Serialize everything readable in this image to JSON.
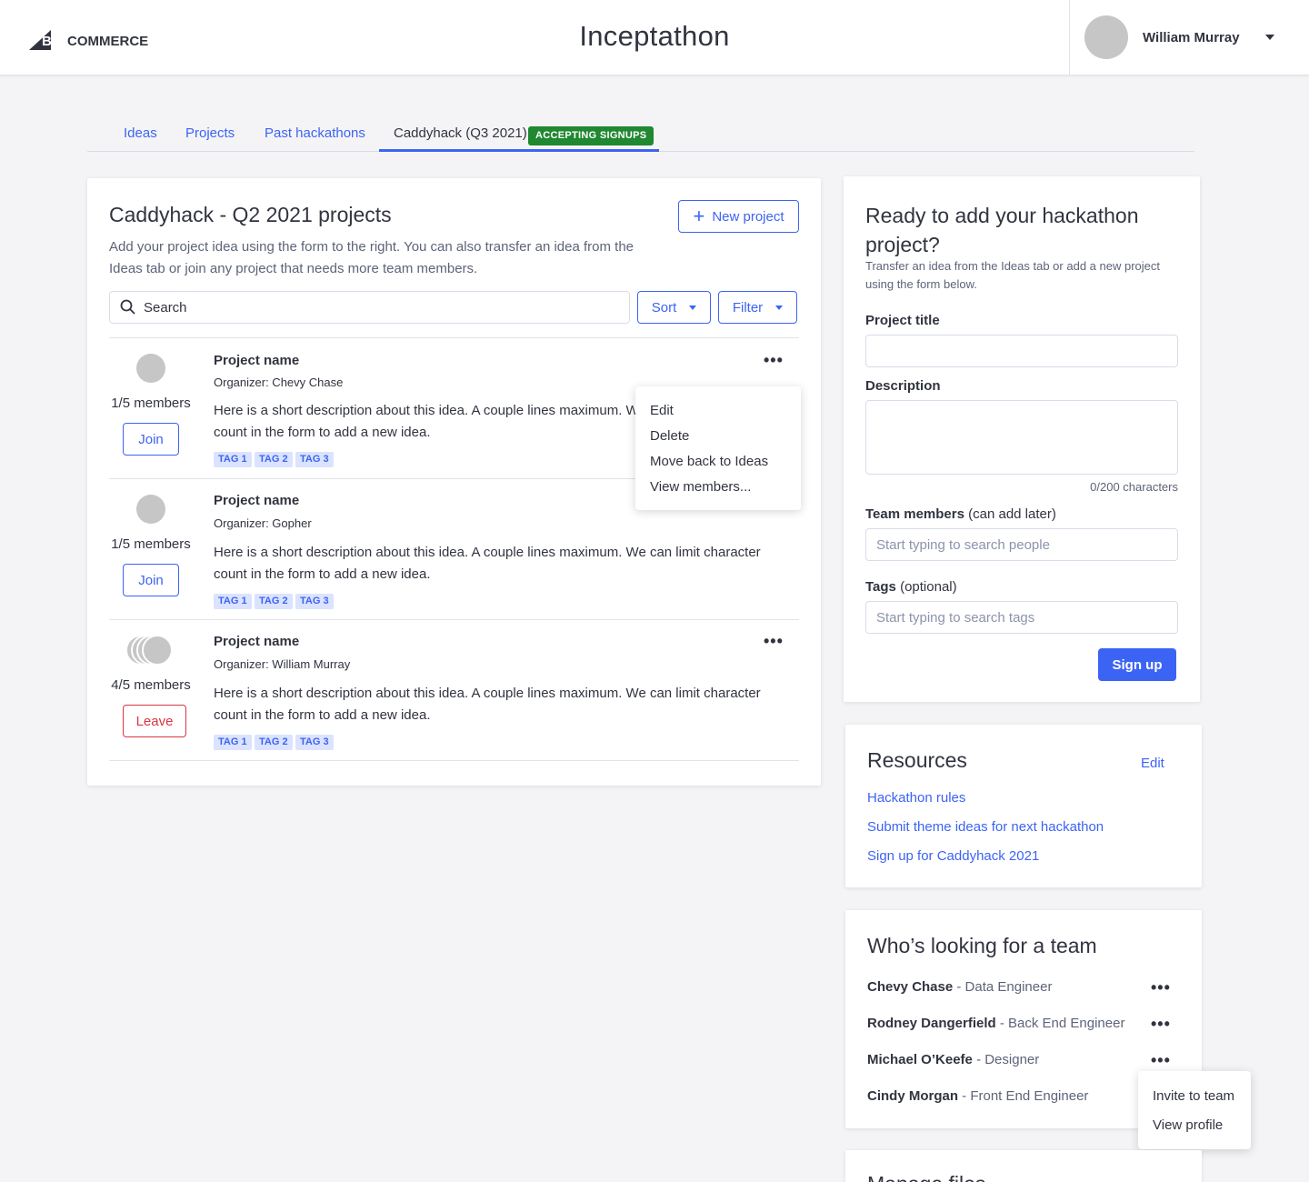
{
  "header": {
    "app_title": "Inceptathon",
    "logo_text_big": "BIG",
    "logo_text_commerce": "COMMERCE",
    "user_name": "William Murray"
  },
  "tabs": [
    {
      "label": "Ideas"
    },
    {
      "label": "Projects"
    },
    {
      "label": "Past hackathons"
    },
    {
      "label": "Caddyhack (Q3 2021)",
      "badge": "ACCEPTING SIGNUPS",
      "active": true
    }
  ],
  "projects": {
    "title": "Caddyhack - Q2 2021 projects",
    "subtitle_line1": "Add your project idea using the form to the right. You can also transfer an idea from the",
    "subtitle_line2": "Ideas tab or join any project that needs more team members.",
    "new_project_label": "New project",
    "search_placeholder": "Search",
    "sort_label": "Sort",
    "filter_label": "Filter",
    "items": [
      {
        "name": "Project name",
        "organizer": "Organizer: Chevy Chase",
        "members": "1/5 members",
        "action": "Join",
        "desc_line1": "Here is a short description about this idea. A couple lines maximum. We can limit character",
        "desc_line2": "count in the form to add a new idea.",
        "tags": [
          "TAG 1",
          "TAG 2",
          "TAG 3"
        ]
      },
      {
        "name": "Project name",
        "organizer": "Organizer: Gopher",
        "members": "1/5 members",
        "action": "Join",
        "desc_line1": "Here is a short description about this idea. A couple lines maximum. We can limit character",
        "desc_line2": "count in the form to add a new idea.",
        "tags": [
          "TAG 1",
          "TAG 2",
          "TAG 3"
        ]
      },
      {
        "name": "Project name",
        "organizer": "Organizer: William Murray",
        "members": "4/5 members",
        "action": "Leave",
        "desc_line1": "Here is a short description about this idea. A couple lines maximum. We can limit character",
        "desc_line2": "count in the form to add a new idea.",
        "tags": [
          "TAG 1",
          "TAG 2",
          "TAG 3"
        ]
      }
    ],
    "context_menu": [
      "Edit",
      "Delete",
      "Move back to Ideas",
      "View members..."
    ]
  },
  "form": {
    "title_line1": "Ready to add your hackathon",
    "title_line2": "project?",
    "subtitle_line1": "Transfer an idea from the Ideas tab or add a new project",
    "subtitle_line2": "using the form below.",
    "project_title_label": "Project title",
    "description_label": "Description",
    "char_count": "0/200 characters",
    "team_label": "Team members",
    "team_label_note": "(can add later)",
    "team_placeholder": "Start typing to search people",
    "tags_label": "Tags",
    "tags_label_note": "(optional)",
    "tags_placeholder": "Start typing to search tags",
    "submit_label": "Sign up"
  },
  "resources": {
    "title": "Resources",
    "edit_label": "Edit",
    "links": [
      "Hackathon rules",
      "Submit theme ideas for next hackathon",
      "Sign up for Caddyhack 2021"
    ]
  },
  "who": {
    "title": "Who’s looking for a team",
    "people": [
      {
        "name": "Chevy Chase",
        "role": "- Data Engineer"
      },
      {
        "name": "Rodney Dangerfield",
        "role": "- Back End Engineer"
      },
      {
        "name": "Michael O’Keefe",
        "role": "- Designer"
      },
      {
        "name": "Cindy Morgan",
        "role": "- Front End Engineer"
      }
    ],
    "menu": [
      "Invite to team",
      "View profile"
    ]
  },
  "more": {
    "title": "Manage files"
  },
  "colors": {
    "accent": "#3c64f4",
    "success": "#208831",
    "danger": "#db3643",
    "tag_bg": "#dbe3fe"
  }
}
